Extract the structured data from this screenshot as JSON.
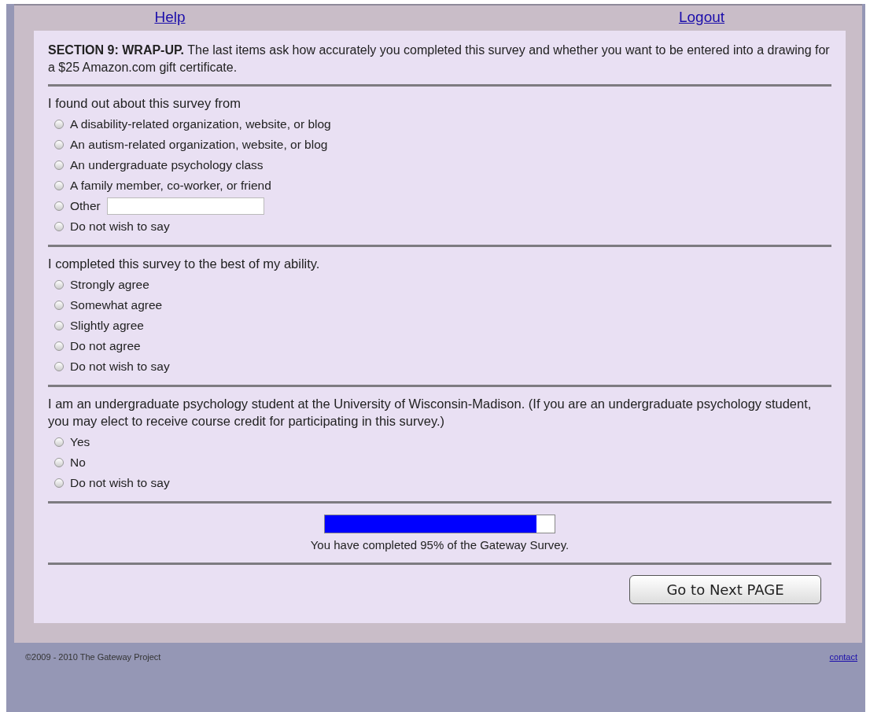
{
  "nav": {
    "links": [
      "Help",
      "Logout"
    ]
  },
  "intro": "**SECTION 9: WRAP-UP.** The last items ask how accurately you completed this survey and whether you want to be entered into a drawing for a $25 Amazon.com gift certificate.",
  "questions": [
    {
      "prompt": "I found out about this survey from",
      "options": [
        {
          "label": "A disability-related organization, website, or blog",
          "selected": false
        },
        {
          "label": "An autism-related organization, website, or blog",
          "selected": false
        },
        {
          "label": "An undergraduate psychology class",
          "selected": false
        },
        {
          "label": "A family member, co-worker, or friend",
          "selected": false
        },
        {
          "label": "Other",
          "selected": false,
          "kind": "text"
        },
        {
          "label": "Do not wish to say",
          "selected": false
        }
      ]
    },
    {
      "prompt": "I completed this survey to the best of my ability.",
      "options": [
        {
          "label": "Strongly agree",
          "selected": false
        },
        {
          "label": "Somewhat agree",
          "selected": false
        },
        {
          "label": "Slightly agree",
          "selected": false
        },
        {
          "label": "Do not agree",
          "selected": false
        },
        {
          "label": "Do not wish to say",
          "selected": false
        }
      ]
    },
    {
      "prompt": "I am an undergraduate psychology student at the University of Wisconsin-Madison. (If you are an undergraduate psychology student, you may elect to receive course credit for participating in this survey.)",
      "options": [
        {
          "label": "Yes",
          "selected": false
        },
        {
          "label": "No",
          "selected": false
        },
        {
          "label": "Do not wish to say",
          "selected": false
        }
      ]
    }
  ],
  "progress": {
    "level": 0.92,
    "caption": "You have completed 95% of the Gateway Survey."
  },
  "next_button": "Go to Next PAGE",
  "footer": {
    "copyright": "©2009 - 2010 The Gateway Project",
    "link": "contact"
  }
}
